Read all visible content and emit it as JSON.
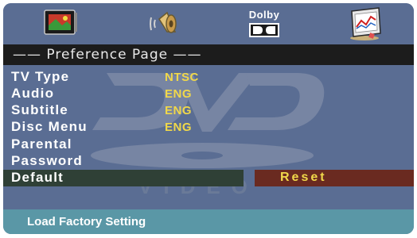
{
  "toolbar": {
    "icons": [
      "tv-picture-icon",
      "speaker-audio-icon",
      "dolby-digital-icon",
      "preference-chart-icon"
    ],
    "dolby_label": "Dolby"
  },
  "page_header": {
    "title": "—— Preference Page ——"
  },
  "settings": [
    {
      "label": "TV Type",
      "value": "NTSC"
    },
    {
      "label": "Audio",
      "value": "ENG"
    },
    {
      "label": "Subtitle",
      "value": "ENG"
    },
    {
      "label": "Disc Menu",
      "value": "ENG"
    },
    {
      "label": "Parental",
      "value": ""
    },
    {
      "label": "Password",
      "value": ""
    },
    {
      "label": "Default",
      "value": ""
    }
  ],
  "reset_label": "Reset",
  "footer": {
    "hint": "Load Factory Setting"
  },
  "colors": {
    "background": "#5a6d93",
    "header_bar": "#1c1c1c",
    "value_text": "#f0d84a",
    "selected_row": "#2f4036",
    "reset_highlight": "#6a2a20",
    "footer_bar": "#5a97a6"
  }
}
